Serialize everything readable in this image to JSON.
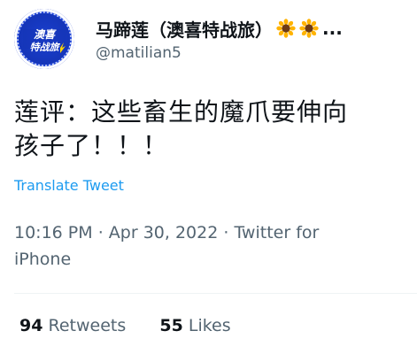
{
  "author": {
    "display_name": "马蹄莲（澳喜特战旅）",
    "ellipsis": "...",
    "handle": "@matilian5",
    "avatar_text": "澳喜特战旅",
    "emoji": [
      "sunflower-icon",
      "sunflower-icon"
    ]
  },
  "tweet": {
    "line1": "莲评：这些畜生的魔爪要伸向",
    "line2": "孩子了！！！",
    "translate_label": "Translate Tweet",
    "time": "10:16 PM",
    "date": "Apr 30, 2022",
    "source_line1": "Twitter for",
    "source_line2": "iPhone",
    "separator": "·"
  },
  "stats": {
    "retweets_count": "94",
    "retweets_label": "Retweets",
    "likes_count": "55",
    "likes_label": "Likes"
  },
  "colors": {
    "link": "#1d9bf0",
    "secondary_text": "#536471",
    "primary_text": "#0f1419",
    "avatar_blue": "#1535b8"
  }
}
